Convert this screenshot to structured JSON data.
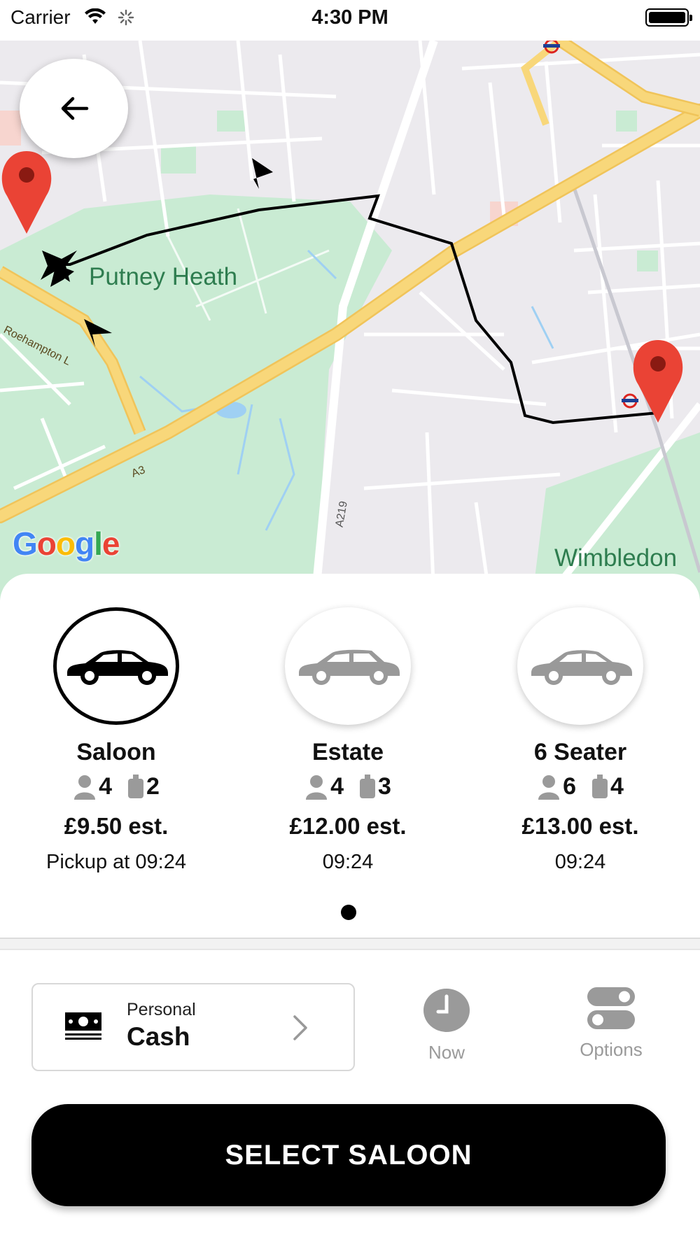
{
  "status_bar": {
    "carrier": "Carrier",
    "time": "4:30 PM"
  },
  "map": {
    "labels": {
      "area_1": "Putney Heath",
      "area_2": "Wimbledon",
      "road_1": "Roehampton L",
      "road_2": "A3",
      "road_3": "A219"
    },
    "attribution": [
      "G",
      "o",
      "o",
      "g",
      "l",
      "e"
    ],
    "colors": {
      "park": "#c9ebd3",
      "major_road": "#f8d77a",
      "route": "#000000",
      "pin": "#ea4335"
    }
  },
  "vehicles": [
    {
      "name": "Saloon",
      "passengers": "4",
      "luggage": "2",
      "price": "£9.50 est.",
      "pickup": "Pickup at 09:24",
      "selected": true
    },
    {
      "name": "Estate",
      "passengers": "4",
      "luggage": "3",
      "price": "£12.00 est.",
      "pickup": "09:24",
      "selected": false
    },
    {
      "name": "6 Seater",
      "passengers": "6",
      "luggage": "4",
      "price": "£13.00 est.",
      "pickup": "09:24",
      "selected": false
    }
  ],
  "payment": {
    "type": "Personal",
    "method": "Cash"
  },
  "time_option": {
    "label": "Now"
  },
  "options": {
    "label": "Options"
  },
  "select_button": {
    "label": "SELECT SALOON"
  }
}
